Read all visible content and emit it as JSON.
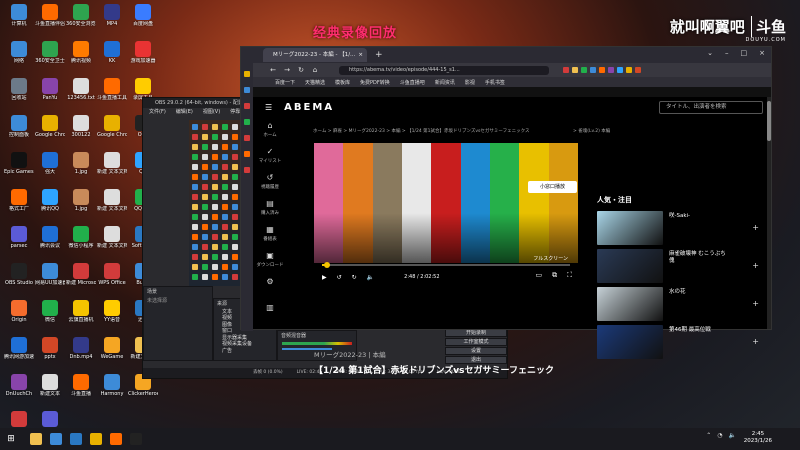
{
  "overlay": {
    "banner": "经典录像回放",
    "streamer_name": "就叫啊翼吧",
    "site_logo": "斗鱼",
    "site_url": "DOUYU.COM"
  },
  "desktop": {
    "icons": [
      {
        "label": "计算机",
        "color": "#3d8bd8"
      },
      {
        "label": "斗鱼直播伴侣",
        "color": "#ff6a00"
      },
      {
        "label": "360安全浏览器",
        "color": "#2ea44f"
      },
      {
        "label": "MP4",
        "color": "#333a8a"
      },
      {
        "label": "百度网盘",
        "color": "#3a7cff"
      },
      {
        "label": "网络",
        "color": "#3d8bd8"
      },
      {
        "label": "360安全卫士",
        "color": "#2ea44f"
      },
      {
        "label": "腾讯视频",
        "color": "#ff7a00"
      },
      {
        "label": "KK",
        "color": "#1f6fd6"
      },
      {
        "label": "游戏加速器",
        "color": "#e93333"
      },
      {
        "label": "回收站",
        "color": "#6c7a89"
      },
      {
        "label": "PanYu",
        "color": "#8844aa"
      },
      {
        "label": "123456.txt",
        "color": "#dddddd"
      },
      {
        "label": "斗鱼直播工具",
        "color": "#ff6a00"
      },
      {
        "label": "录屏工具",
        "color": "#ffcc00"
      },
      {
        "label": "控制面板",
        "color": "#3d8bd8"
      },
      {
        "label": "Google Chrome",
        "color": "#e8b100"
      },
      {
        "label": "300122",
        "color": "#dddddd"
      },
      {
        "label": "Google Chrome",
        "color": "#e8b100"
      },
      {
        "label": "OBS",
        "color": "#222222"
      },
      {
        "label": "Epic Games Launcher",
        "color": "#111111"
      },
      {
        "label": "强大",
        "color": "#1f6fd6"
      },
      {
        "label": "1.jpg",
        "color": "#c98a5a"
      },
      {
        "label": "新建 文本文档",
        "color": "#dddddd"
      },
      {
        "label": "QQ",
        "color": "#2ea4ff"
      },
      {
        "label": "格式工厂",
        "color": "#ff6a00"
      },
      {
        "label": "腾讯QQ",
        "color": "#2ea4ff"
      },
      {
        "label": "1.jpg",
        "color": "#c98a5a"
      },
      {
        "label": "新建 文本文档",
        "color": "#dddddd"
      },
      {
        "label": "QQ音乐",
        "color": "#21b04b"
      },
      {
        "label": "parsec",
        "color": "#5b5bd6"
      },
      {
        "label": "腾讯会议",
        "color": "#1f6fd6"
      },
      {
        "label": "微信小程序",
        "color": "#21b04b"
      },
      {
        "label": "新建 文本文档(2).txt",
        "color": "#dddddd"
      },
      {
        "label": "SoftWare",
        "color": "#2a78c2"
      },
      {
        "label": "OBS Studio",
        "color": "#222222"
      },
      {
        "label": "网易UU加速器",
        "color": "#3d8bd8"
      },
      {
        "label": "新建 Microsoft",
        "color": "#d23b3b"
      },
      {
        "label": "WPS Office",
        "color": "#d23b3b"
      },
      {
        "label": "Burst",
        "color": "#3d8bd8"
      },
      {
        "label": "Origin",
        "color": "#f56c2d"
      },
      {
        "label": "微信",
        "color": "#21b04b"
      },
      {
        "label": "云旗直播机",
        "color": "#f5c400"
      },
      {
        "label": "YY语音",
        "color": "#ffcc00"
      },
      {
        "label": "迅雷",
        "color": "#2a78c2"
      },
      {
        "label": "腾讯网游加速器",
        "color": "#1f6fd6"
      },
      {
        "label": "pptx",
        "color": "#d24726"
      },
      {
        "label": "Dnb.mp4",
        "color": "#333a8a"
      },
      {
        "label": "WeGame",
        "color": "#f5a623"
      },
      {
        "label": "新建文件夹",
        "color": "#f0c050"
      },
      {
        "label": "DnUuchCh",
        "color": "#8844aa"
      },
      {
        "label": "新建文本",
        "color": "#dddddd"
      },
      {
        "label": "斗鱼直播",
        "color": "#ff6a00"
      },
      {
        "label": "Harmony",
        "color": "#3d8bd8"
      },
      {
        "label": "ClickerHeroes",
        "color": "#f5a623"
      },
      {
        "label": "艾从直播Embr",
        "color": "#d23b3b"
      },
      {
        "label": "星期日",
        "color": "#5b5bd6"
      }
    ]
  },
  "obs": {
    "title": "OBS 29.0.2 (64-bit, windows) - 配置文件:...",
    "menu": [
      "文件(F)",
      "编辑(E)",
      "视图(V)",
      "停靠"
    ],
    "scenes_title": "场景",
    "scenes_placeholder": "未选择源",
    "sources_title": "来源",
    "sources": [
      "文本",
      "视频",
      "图像",
      "窗口",
      "显示器采集",
      "视频采集设备",
      "广告"
    ],
    "mixer_title": "音频混音器",
    "buttons": [
      "开始直播",
      "开始录制",
      "工作室模式",
      "设置",
      "退出"
    ],
    "status": [
      "丢帧 0 (0.0%)",
      "LIVE: 02:45",
      "REC: 00:00",
      "CPU: 3.9%, 60.00 fps",
      "kb/s: 3000"
    ]
  },
  "browser": {
    "tab_title": "Mリーグ2022-23 - 本編 - 【1/...",
    "url": "https://abema.tv/video/episode/444-15_s1...",
    "bookmarks": [
      "百度一下",
      "天猫精选",
      "模板库",
      "免费PDF转换",
      "斗鱼直播吧",
      "新闻资讯",
      "影视",
      "手机书签"
    ],
    "abema": {
      "logo": "ABEMA",
      "search_placeholder": "タイトル、出演者を検索",
      "nav": [
        {
          "icon": "⌂",
          "label": "ホーム"
        },
        {
          "icon": "✓",
          "label": "マイリスト"
        },
        {
          "icon": "↺",
          "label": "視聴履歴"
        },
        {
          "icon": "▤",
          "label": "購入済み"
        },
        {
          "icon": "▦",
          "label": "番組表"
        },
        {
          "icon": "▣",
          "label": "ダウンロード"
        },
        {
          "icon": "⚙",
          "label": ""
        },
        {
          "icon": "▥",
          "label": ""
        }
      ],
      "breadcrumb": "ホーム > 麻雀 > Mリーグ2022-23 > 本編 > 【1/24 第1試合】赤坂ドリブンズvsセガサミーフェニックス",
      "breadcrumb_tail": "> 雀魂(Lv.2) 本編",
      "miniplayer_button": "小窓口播放",
      "fullscreen_label": "フルスクリーン",
      "time": "2:48 / 2:02:52",
      "progress_fraction": 0.02,
      "program_label": "Mリーグ2022-23 | 本編",
      "program_title": "【1/24 第1試合】赤坂ドリブンズvsセガサミーフェニック",
      "colorbars": [
        "#e06a9a",
        "#e07a20",
        "#8a7a5e",
        "#e8e8e8",
        "#c81e1e",
        "#1e8ad0",
        "#26b04a",
        "#e8c000",
        "#d89a10"
      ],
      "right_panel_title": "人気・注目",
      "right_items": [
        {
          "label": "咲-Saki-",
          "color": "#a9d6e8"
        },
        {
          "label": "麻雀破壊神 むこうぶち 傀",
          "color": "#2a3a55"
        },
        {
          "label": "水の花",
          "color": "#c7d2d8"
        },
        {
          "label": "第46期 最高位戦",
          "color": "#1b3a7a"
        }
      ]
    }
  },
  "taskbar": {
    "apps": [
      "#f0c050",
      "#3d8bd8",
      "#2a78c2",
      "#e8b100",
      "#ff6a00",
      "#222222"
    ],
    "time": "2:45",
    "date": "2023/1/26"
  }
}
